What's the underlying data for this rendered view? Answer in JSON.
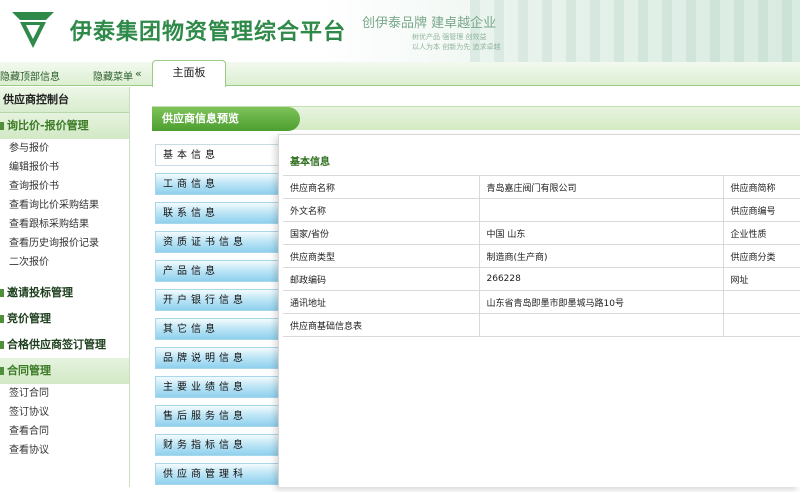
{
  "header": {
    "title": "伊泰集团物资管理综合平台",
    "slogan": "创伊泰品牌 建卓越企业",
    "slogan_sub_line1": "树优产品  强管理  创效益",
    "slogan_sub_line2": "以人为本  创新为先  追求卓越",
    "brand_color": "#2f8a4a"
  },
  "navbar": {
    "hide_top": "隐藏顶部信息",
    "hide_menu": "隐藏菜单",
    "collapse_icon": "double-chevron-left-icon",
    "main_tab": "主面板"
  },
  "sidebar": {
    "title": "供应商控制台",
    "groups": [
      {
        "label": "询比价-报价管理",
        "items": [
          "参与报价",
          "编辑报价书",
          "查询报价书",
          "查看询比价采购结果",
          "查看跟标采购结果",
          "查看历史询报价记录",
          "二次报价"
        ]
      },
      {
        "label": "邀请投标管理"
      },
      {
        "label": "竞价管理"
      },
      {
        "label": "合格供应商签订管理"
      },
      {
        "label": "合同管理",
        "items": [
          "签订合同",
          "签订协议",
          "查看合同",
          "查看协议"
        ]
      }
    ]
  },
  "content": {
    "preview_title": "供应商信息预览",
    "tabs": [
      "基本信息",
      "工商信息",
      "联系信息",
      "资质证书信息",
      "产品信息",
      "开户银行信息",
      "其它信息",
      "品牌说明信息",
      "主要业绩信息",
      "售后服务信息",
      "财务指标信息",
      "供应商管理科"
    ],
    "panel_title": "基本信息",
    "rows": [
      {
        "label": "供应商名称",
        "value": "青岛嘉庄阀门有限公司",
        "label2": "供应商简称"
      },
      {
        "label": "外文名称",
        "value": "",
        "label2": "供应商编号"
      },
      {
        "label": "国家/省份",
        "value": "中国  山东",
        "label2": "企业性质"
      },
      {
        "label": "供应商类型",
        "value": "制造商(生产商)",
        "label2": "供应商分类"
      },
      {
        "label": "邮政编码",
        "value": "266228",
        "label2": "网址"
      },
      {
        "label": "通讯地址",
        "value": "山东省青岛即墨市即墨城马路10号",
        "label2": ""
      },
      {
        "label": "供应商基础信息表",
        "value": "",
        "label2": ""
      }
    ]
  }
}
